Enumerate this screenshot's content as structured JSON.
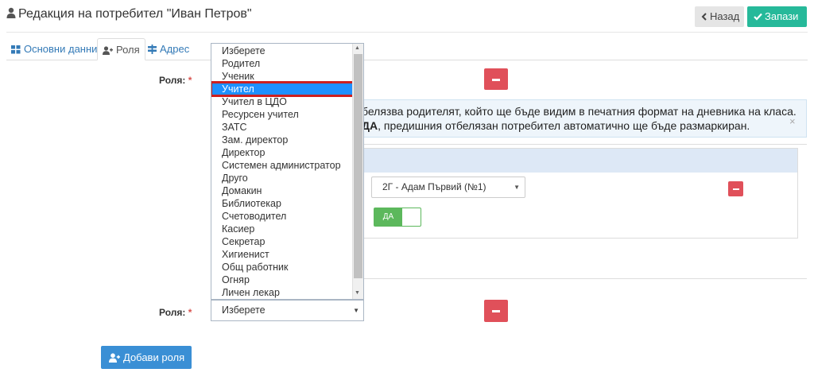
{
  "header": {
    "title": "Редакция на потребител \"Иван Петров\"",
    "back_label": "Назад",
    "save_label": "Запази"
  },
  "tabs": [
    {
      "label": "Основни данни",
      "icon": "grid-icon"
    },
    {
      "label": "Роля",
      "icon": "user-plus-icon",
      "active": true
    },
    {
      "label": "Адрес",
      "icon": "signpost-icon"
    }
  ],
  "form": {
    "role_label": "Роля:",
    "required_mark": "*",
    "dropdown_options": [
      "Изберете",
      "Родител",
      "Ученик",
      "Учител",
      "Учител в ЦДО",
      "Ресурсен учител",
      "ЗАТС",
      "Зам. директор",
      "Директор",
      "Системен администратор",
      "Друго",
      "Домакин",
      "Библиотекар",
      "Счетоводител",
      "Касиер",
      "Секретар",
      "Хигиенист",
      "Общ работник",
      "Огняр",
      "Личен лекар"
    ],
    "selected_option": "Учител",
    "second_select_value": "Изберете",
    "add_role_label": "Добави роля"
  },
  "alert": {
    "line1": "белязва родителят, който ще бъде видим в печатния формат на дневника на класа.",
    "line2_bold": "ДА",
    "line2_rest": ", предишния отбелязан потребител автоматично ще бъде размаркиран.",
    "close": "×"
  },
  "class_panel": {
    "class_select_value": "2Г - Адам Първий (№1)",
    "toggle_label": "ДА"
  },
  "colors": {
    "save": "#26b99a",
    "danger": "#e0505a",
    "primary": "#3a8fd5",
    "toggle": "#5cb85c",
    "selected": "#1e90ff",
    "highlight": "#cc1f1f"
  }
}
